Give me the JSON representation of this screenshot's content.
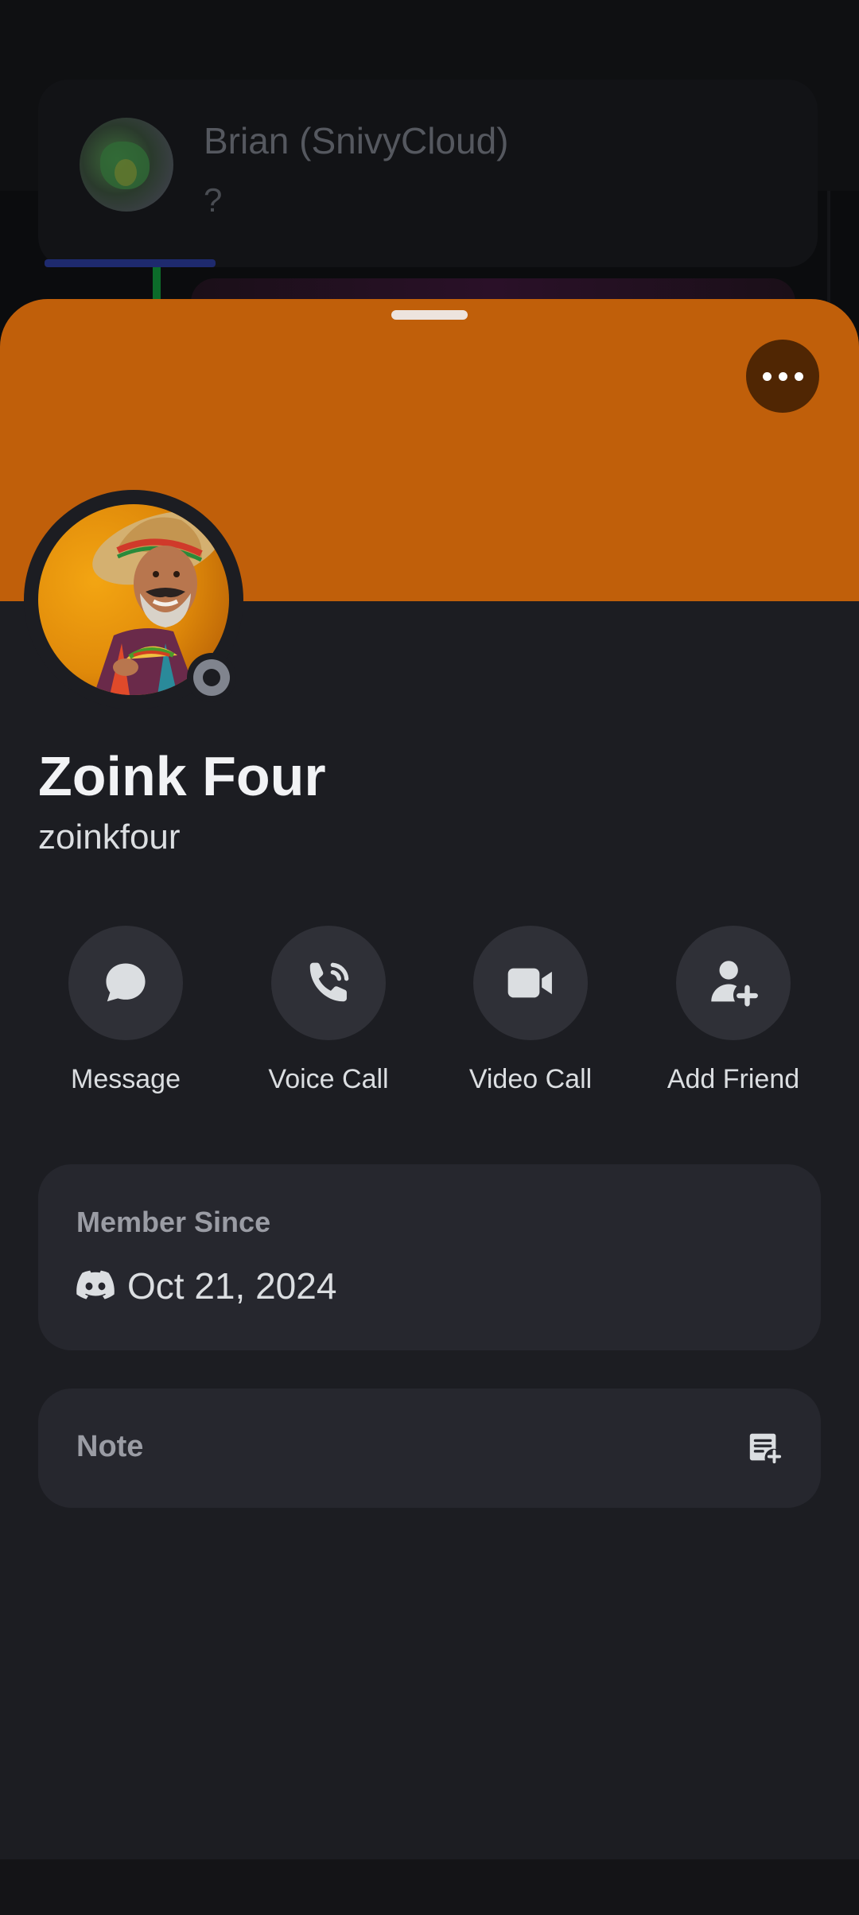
{
  "background": {
    "dm_preview": {
      "name": "Brian (SnivyCloud)",
      "message": "?"
    }
  },
  "profile": {
    "banner_color": "#c05f0a",
    "display_name": "Zoink Four",
    "username": "zoinkfour",
    "status": "offline"
  },
  "actions": [
    {
      "label": "Message",
      "icon": "chat-bubble-icon"
    },
    {
      "label": "Voice Call",
      "icon": "phone-icon"
    },
    {
      "label": "Video Call",
      "icon": "video-camera-icon"
    },
    {
      "label": "Add Friend",
      "icon": "add-friend-icon"
    }
  ],
  "member_since": {
    "title": "Member Since",
    "date": "Oct 21, 2024",
    "icon": "discord-icon"
  },
  "note": {
    "label": "Note",
    "icon": "note-add-icon"
  }
}
